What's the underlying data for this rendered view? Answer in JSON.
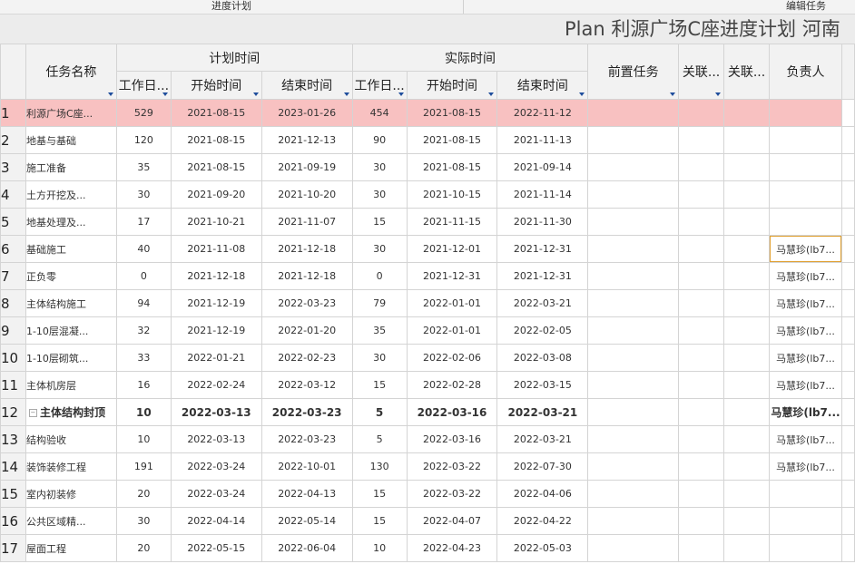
{
  "ribbon": {
    "group1": "进度计划",
    "group2": "编辑任务"
  },
  "title": "Plan 利源广场C座进度计划 河南",
  "headers": {
    "task_name": "任务名称",
    "planned_time": "计划时间",
    "actual_time": "实际时间",
    "work_days": "工作日...",
    "start": "开始时间",
    "end": "结束时间",
    "predecessor": "前置任务",
    "related1": "关联...",
    "related2": "关联...",
    "owner": "负责人"
  },
  "rows": [
    {
      "n": "1",
      "name": "利源广场C座...",
      "pd": "529",
      "ps": "2021-08-15",
      "pe": "2023-01-26",
      "ad": "454",
      "as": "2021-08-15",
      "ae": "2022-11-12",
      "owner": ""
    },
    {
      "n": "2",
      "name": "地基与基础",
      "pd": "120",
      "ps": "2021-08-15",
      "pe": "2021-12-13",
      "ad": "90",
      "as": "2021-08-15",
      "ae": "2021-11-13",
      "owner": ""
    },
    {
      "n": "3",
      "name": "施工准备",
      "pd": "35",
      "ps": "2021-08-15",
      "pe": "2021-09-19",
      "ad": "30",
      "as": "2021-08-15",
      "ae": "2021-09-14",
      "owner": ""
    },
    {
      "n": "4",
      "name": "土方开挖及...",
      "pd": "30",
      "ps": "2021-09-20",
      "pe": "2021-10-20",
      "ad": "30",
      "as": "2021-10-15",
      "ae": "2021-11-14",
      "owner": ""
    },
    {
      "n": "5",
      "name": "地基处理及...",
      "pd": "17",
      "ps": "2021-10-21",
      "pe": "2021-11-07",
      "ad": "15",
      "as": "2021-11-15",
      "ae": "2021-11-30",
      "owner": ""
    },
    {
      "n": "6",
      "name": "基础施工",
      "pd": "40",
      "ps": "2021-11-08",
      "pe": "2021-12-18",
      "ad": "30",
      "as": "2021-12-01",
      "ae": "2021-12-31",
      "owner": "马慧珍(lb7..."
    },
    {
      "n": "7",
      "name": "正负零",
      "pd": "0",
      "ps": "2021-12-18",
      "pe": "2021-12-18",
      "ad": "0",
      "as": "2021-12-31",
      "ae": "2021-12-31",
      "owner": "马慧珍(lb7..."
    },
    {
      "n": "8",
      "name": "主体结构施工",
      "pd": "94",
      "ps": "2021-12-19",
      "pe": "2022-03-23",
      "ad": "79",
      "as": "2022-01-01",
      "ae": "2022-03-21",
      "owner": "马慧珍(lb7..."
    },
    {
      "n": "9",
      "name": "1-10层混凝...",
      "pd": "32",
      "ps": "2021-12-19",
      "pe": "2022-01-20",
      "ad": "35",
      "as": "2022-01-01",
      "ae": "2022-02-05",
      "owner": "马慧珍(lb7..."
    },
    {
      "n": "10",
      "name": "1-10层砌筑...",
      "pd": "33",
      "ps": "2022-01-21",
      "pe": "2022-02-23",
      "ad": "30",
      "as": "2022-02-06",
      "ae": "2022-03-08",
      "owner": "马慧珍(lb7..."
    },
    {
      "n": "11",
      "name": "主体机房层",
      "pd": "16",
      "ps": "2022-02-24",
      "pe": "2022-03-12",
      "ad": "15",
      "as": "2022-02-28",
      "ae": "2022-03-15",
      "owner": "马慧珍(lb7..."
    },
    {
      "n": "12",
      "name": "主体结构封顶",
      "pd": "10",
      "ps": "2022-03-13",
      "pe": "2022-03-23",
      "ad": "5",
      "as": "2022-03-16",
      "ae": "2022-03-21",
      "owner": "马慧珍(lb7..."
    },
    {
      "n": "13",
      "name": "结构验收",
      "pd": "10",
      "ps": "2022-03-13",
      "pe": "2022-03-23",
      "ad": "5",
      "as": "2022-03-16",
      "ae": "2022-03-21",
      "owner": "马慧珍(lb7..."
    },
    {
      "n": "14",
      "name": "装饰装修工程",
      "pd": "191",
      "ps": "2022-03-24",
      "pe": "2022-10-01",
      "ad": "130",
      "as": "2022-03-22",
      "ae": "2022-07-30",
      "owner": "马慧珍(lb7..."
    },
    {
      "n": "15",
      "name": "室内初装修",
      "pd": "20",
      "ps": "2022-03-24",
      "pe": "2022-04-13",
      "ad": "15",
      "as": "2022-03-22",
      "ae": "2022-04-06",
      "owner": ""
    },
    {
      "n": "16",
      "name": "公共区域精...",
      "pd": "30",
      "ps": "2022-04-14",
      "pe": "2022-05-14",
      "ad": "15",
      "as": "2022-04-07",
      "ae": "2022-04-22",
      "owner": ""
    },
    {
      "n": "17",
      "name": "屋面工程",
      "pd": "20",
      "ps": "2022-05-15",
      "pe": "2022-06-04",
      "ad": "10",
      "as": "2022-04-23",
      "ae": "2022-05-03",
      "owner": ""
    }
  ]
}
